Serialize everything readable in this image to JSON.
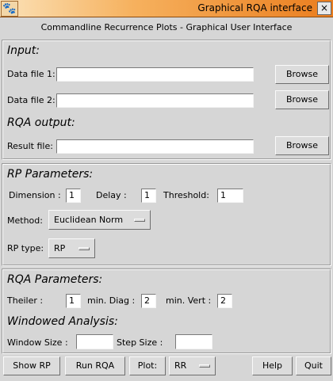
{
  "window": {
    "title": "Graphical RQA interface",
    "close_glyph": "×",
    "icon": "gnome-foot-icon"
  },
  "subtitle": "Commandline Recurrence Plots - Graphical User Interface",
  "input": {
    "heading": "Input:",
    "data_file_1": {
      "label": "Data file 1:",
      "value": "",
      "browse": "Browse"
    },
    "data_file_2": {
      "label": "Data file 2:",
      "value": "",
      "browse": "Browse"
    }
  },
  "rqa_output": {
    "heading": "RQA output:",
    "result_file": {
      "label": "Result file:",
      "value": "",
      "browse": "Browse"
    }
  },
  "rp_params": {
    "heading": "RP Parameters:",
    "dimension_label": "Dimension :",
    "dimension": "1",
    "delay_label": "Delay :",
    "delay": "1",
    "threshold_label": "Threshold:",
    "threshold": "1",
    "method_label": "Method:",
    "method": "Euclidean Norm",
    "rp_type_label": "RP type:",
    "rp_type": "RP"
  },
  "rqa_params": {
    "heading": "RQA Parameters:",
    "theiler_label": "Theiler :",
    "theiler": "1",
    "min_diag_label": "min. Diag :",
    "min_diag": "2",
    "min_vert_label": "min. Vert :",
    "min_vert": "2",
    "windowed_heading": "Windowed Analysis:",
    "window_size_label": "Window Size :",
    "window_size": "",
    "step_size_label": "Step Size :",
    "step_size": ""
  },
  "bottom": {
    "show_rp": "Show RP",
    "run_rqa": "Run RQA",
    "plot_label": "Plot:",
    "plot_value": "RR",
    "help": "Help",
    "quit": "Quit"
  }
}
